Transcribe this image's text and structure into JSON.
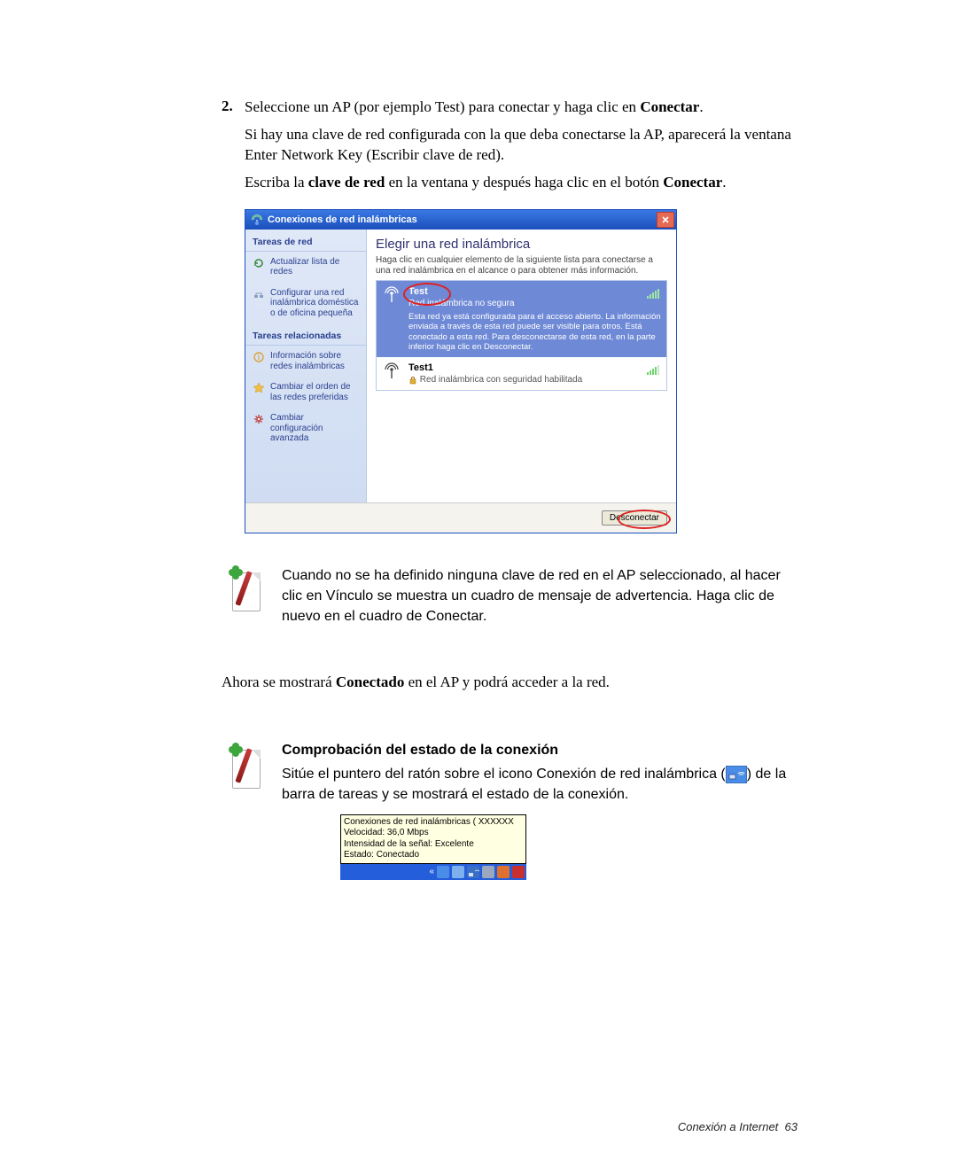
{
  "step": {
    "number": "2.",
    "line1_a": "Seleccione un AP (por ejemplo Test) para conectar y haga clic en ",
    "line1_bold": "Conectar",
    "line1_b": ".",
    "line2": "Si hay una clave de red configurada con la que deba conectarse la AP, aparecerá la ventana Enter Network Key (Escribir clave de red).",
    "line3_a": "Escriba la ",
    "line3_bold1": "clave de red",
    "line3_b": " en la ventana y después haga clic en el botón ",
    "line3_bold2": "Conectar",
    "line3_c": "."
  },
  "dialog": {
    "title": "Conexiones de red inalámbricas",
    "sidebar": {
      "hdr1": "Tareas de red",
      "item1": "Actualizar lista de redes",
      "item2": "Configurar una red inalámbrica doméstica o de oficina pequeña",
      "hdr2": "Tareas relacionadas",
      "item3": "Información sobre redes inalámbricas",
      "item4": "Cambiar el orden de las redes preferidas",
      "item5": "Cambiar configuración avanzada"
    },
    "main": {
      "title": "Elegir una red inalámbrica",
      "subtitle": "Haga clic en cualquier elemento de la siguiente lista para conectarse a una red inalámbrica en el alcance o para obtener más información.",
      "net1": {
        "name": "Test",
        "status": "Red inalámbrica no segura",
        "desc": "Esta red ya está configurada para el acceso abierto. La información enviada a través de esta red puede ser visible para otros. Está conectado a esta red. Para desconectarse de esta red, en la parte inferior haga clic en Desconectar."
      },
      "net2": {
        "name": "Test1",
        "status": "Red inalámbrica con seguridad habilitada"
      },
      "button": "Desconectar"
    }
  },
  "note1": "Cuando no se ha definido ninguna clave de red en el AP seleccionado, al hacer clic en Vínculo se muestra un cuadro de mensaje de advertencia. Haga clic de nuevo en el cuadro de Conectar.",
  "afterline_a": "Ahora se mostrará ",
  "afterline_bold": "Conectado",
  "afterline_b": " en el AP y podrá acceder a la red.",
  "section2": {
    "heading": "Comprobación del estado de la conexión",
    "body_a": "Sitúe el puntero del ratón sobre el icono Conexión de red inalámbrica (",
    "body_b": ") de la barra de tareas y se mostrará el estado de la conexión."
  },
  "tooltip": {
    "l1": "Conexiones de red inalámbricas (  XXXXXX",
    "l2": "Velocidad: 36,0 Mbps",
    "l3": "Intensidad de la señal: Excelente",
    "l4": "Estado: Conectado"
  },
  "footer": {
    "text": "Conexión a Internet",
    "page": "63"
  }
}
